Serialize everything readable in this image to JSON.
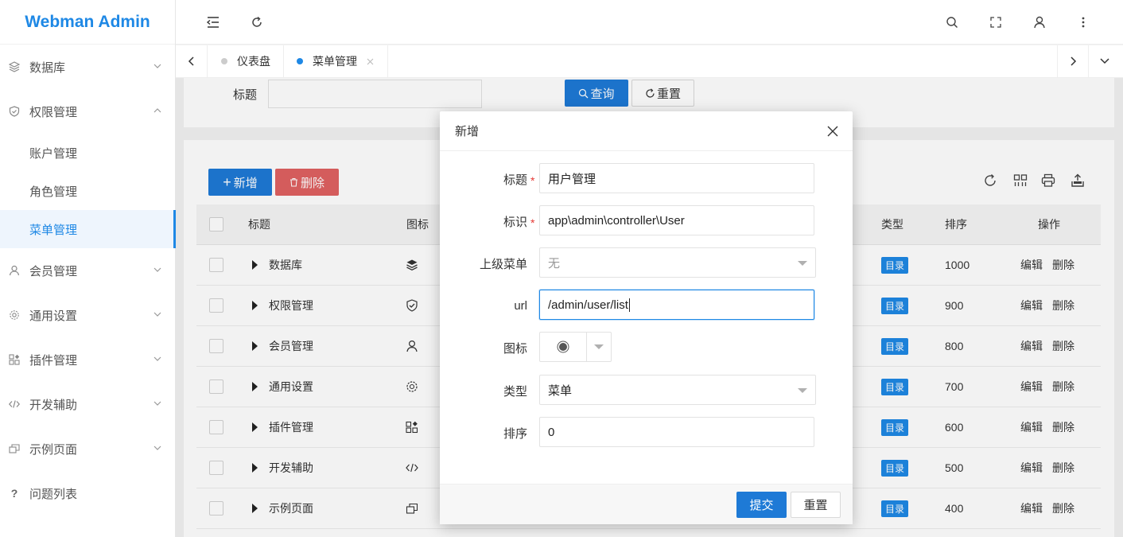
{
  "app": {
    "logo": "Webman Admin"
  },
  "sidebar": {
    "items": [
      {
        "label": "数据库",
        "icon": "layers-icon",
        "expanded": false
      },
      {
        "label": "权限管理",
        "icon": "shield-icon",
        "expanded": true,
        "children": [
          {
            "label": "账户管理",
            "active": false
          },
          {
            "label": "角色管理",
            "active": false
          },
          {
            "label": "菜单管理",
            "active": true
          }
        ]
      },
      {
        "label": "会员管理",
        "icon": "user-icon",
        "expanded": false
      },
      {
        "label": "通用设置",
        "icon": "gear-icon",
        "expanded": false
      },
      {
        "label": "插件管理",
        "icon": "apps-icon",
        "expanded": false
      },
      {
        "label": "开发辅助",
        "icon": "code-icon",
        "expanded": false
      },
      {
        "label": "示例页面",
        "icon": "copy-icon",
        "expanded": false
      },
      {
        "label": "问题列表",
        "icon": "question-icon",
        "expanded": false
      }
    ]
  },
  "tabs": [
    {
      "label": "仪表盘",
      "active": false
    },
    {
      "label": "菜单管理",
      "active": true
    }
  ],
  "search": {
    "title_label": "标题",
    "query_label": "查询",
    "reset_label": "重置"
  },
  "toolbar": {
    "add_label": "新增",
    "delete_label": "删除"
  },
  "table": {
    "headers": {
      "title": "标题",
      "icon": "图标",
      "type": "类型",
      "sort": "排序",
      "actions": "操作"
    },
    "rows": [
      {
        "title": "数据库",
        "icon": "layers-icon",
        "type": "目录",
        "sort": "1000",
        "edit": "编辑",
        "del": "删除"
      },
      {
        "title": "权限管理",
        "icon": "shield-icon",
        "type": "目录",
        "sort": "900",
        "edit": "编辑",
        "del": "删除"
      },
      {
        "title": "会员管理",
        "icon": "user-icon",
        "type": "目录",
        "sort": "800",
        "edit": "编辑",
        "del": "删除"
      },
      {
        "title": "通用设置",
        "icon": "gear-icon",
        "type": "目录",
        "sort": "700",
        "edit": "编辑",
        "del": "删除"
      },
      {
        "title": "插件管理",
        "icon": "apps-icon",
        "type": "目录",
        "sort": "600",
        "edit": "编辑",
        "del": "删除"
      },
      {
        "title": "开发辅助",
        "icon": "code-icon",
        "type": "目录",
        "sort": "500",
        "edit": "编辑",
        "del": "删除"
      },
      {
        "title": "示例页面",
        "icon": "copy-icon",
        "type": "目录",
        "sort": "400",
        "edit": "编辑",
        "del": "删除"
      }
    ]
  },
  "modal": {
    "title": "新增",
    "fields": {
      "title": {
        "label": "标题",
        "value": "用户管理",
        "required": true
      },
      "key": {
        "label": "标识",
        "value": "app\\admin\\controller\\User",
        "required": true
      },
      "parent": {
        "label": "上级菜单",
        "value": "无"
      },
      "url": {
        "label": "url",
        "value": "/admin/user/list"
      },
      "icon": {
        "label": "图标"
      },
      "type": {
        "label": "类型",
        "value": "菜单"
      },
      "sort": {
        "label": "排序",
        "value": "0"
      }
    },
    "submit_label": "提交",
    "reset_label": "重置"
  },
  "colors": {
    "primary": "#1e88e5",
    "danger": "#e06161",
    "logo": "#1e88e5"
  }
}
